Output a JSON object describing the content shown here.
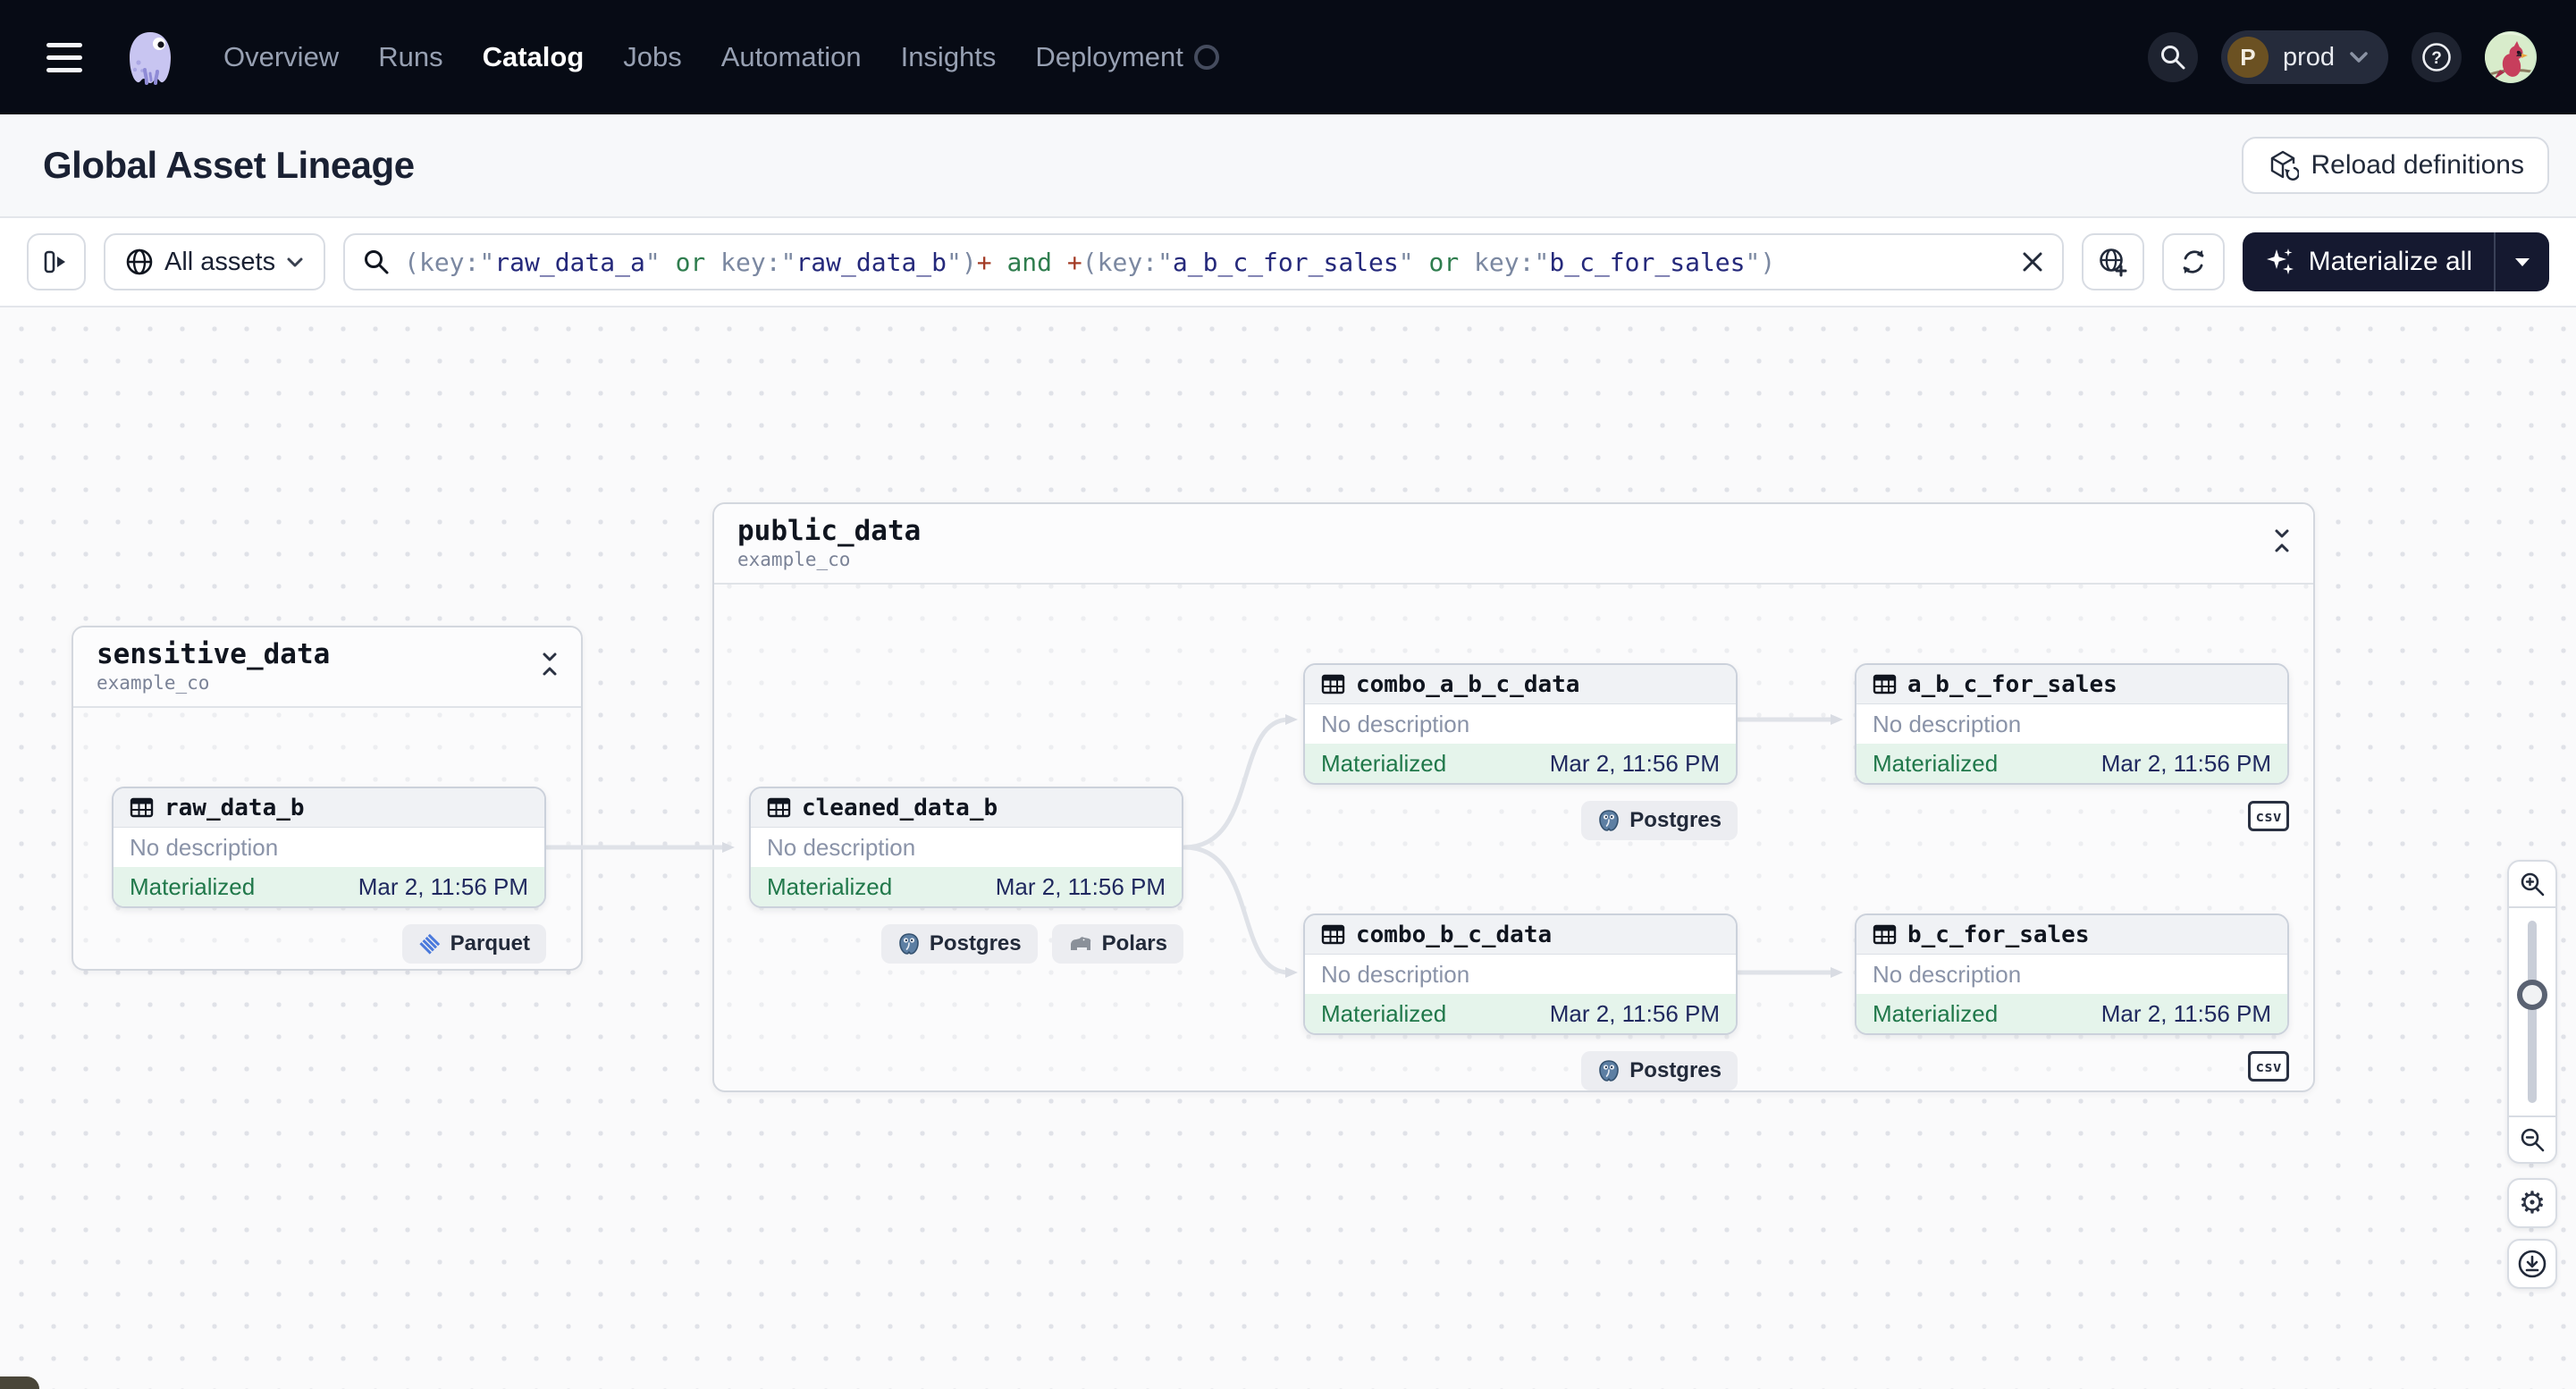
{
  "topnav": {
    "nav_items": [
      {
        "label": "Overview"
      },
      {
        "label": "Runs"
      },
      {
        "label": "Catalog"
      },
      {
        "label": "Jobs"
      },
      {
        "label": "Automation"
      },
      {
        "label": "Insights"
      },
      {
        "label": "Deployment"
      }
    ],
    "active_item": "Catalog",
    "deployment_switcher": {
      "initial": "P",
      "name": "prod"
    }
  },
  "page_header": {
    "title": "Global Asset Lineage",
    "reload_button": "Reload definitions"
  },
  "toolbar": {
    "scope_button": "All assets",
    "materialize_button": "Materialize all",
    "query_segments": [
      {
        "t": "(key:",
        "c": "p"
      },
      {
        "t": "\"",
        "c": "p"
      },
      {
        "t": "raw_data_a",
        "c": "v"
      },
      {
        "t": "\"",
        "c": "p"
      },
      {
        "t": " ",
        "c": "p"
      },
      {
        "t": "or",
        "c": "k"
      },
      {
        "t": " key:",
        "c": "p"
      },
      {
        "t": "\"",
        "c": "p"
      },
      {
        "t": "raw_data_b",
        "c": "v"
      },
      {
        "t": "\"",
        "c": "p"
      },
      {
        "t": ")",
        "c": "p"
      },
      {
        "t": "+",
        "c": "o"
      },
      {
        "t": " ",
        "c": "p"
      },
      {
        "t": "and",
        "c": "k"
      },
      {
        "t": " ",
        "c": "p"
      },
      {
        "t": "+",
        "c": "o"
      },
      {
        "t": "(key:",
        "c": "p"
      },
      {
        "t": "\"",
        "c": "p"
      },
      {
        "t": "a_b_c_for_sales",
        "c": "v"
      },
      {
        "t": "\"",
        "c": "p"
      },
      {
        "t": " ",
        "c": "p"
      },
      {
        "t": "or",
        "c": "k"
      },
      {
        "t": " key:",
        "c": "p"
      },
      {
        "t": "\"",
        "c": "p"
      },
      {
        "t": "b_c_for_sales",
        "c": "v"
      },
      {
        "t": "\"",
        "c": "p"
      },
      {
        "t": ")",
        "c": "p"
      }
    ]
  },
  "graph": {
    "groups": [
      {
        "name": "sensitive_data",
        "location": "example_co"
      },
      {
        "name": "public_data",
        "location": "example_co"
      }
    ],
    "nodes": [
      {
        "name": "raw_data_b",
        "group": "sensitive_data",
        "description": "No description",
        "status": "Materialized",
        "timestamp": "Mar 2, 11:56 PM",
        "badges": [
          "Parquet"
        ]
      },
      {
        "name": "cleaned_data_b",
        "group": "public_data",
        "description": "No description",
        "status": "Materialized",
        "timestamp": "Mar 2, 11:56 PM",
        "badges": [
          "Postgres",
          "Polars"
        ]
      },
      {
        "name": "combo_a_b_c_data",
        "group": "public_data",
        "description": "No description",
        "status": "Materialized",
        "timestamp": "Mar 2, 11:56 PM",
        "badges": [
          "Postgres"
        ]
      },
      {
        "name": "a_b_c_for_sales",
        "group": "public_data",
        "description": "No description",
        "status": "Materialized",
        "timestamp": "Mar 2, 11:56 PM",
        "badges": [
          "csv"
        ]
      },
      {
        "name": "combo_b_c_data",
        "group": "public_data",
        "description": "No description",
        "status": "Materialized",
        "timestamp": "Mar 2, 11:56 PM",
        "badges": [
          "Postgres"
        ]
      },
      {
        "name": "b_c_for_sales",
        "group": "public_data",
        "description": "No description",
        "status": "Materialized",
        "timestamp": "Mar 2, 11:56 PM",
        "badges": [
          "csv"
        ]
      }
    ],
    "edges": [
      {
        "from": "raw_data_b",
        "to": "cleaned_data_b"
      },
      {
        "from": "cleaned_data_b",
        "to": "combo_a_b_c_data"
      },
      {
        "from": "cleaned_data_b",
        "to": "combo_b_c_data"
      },
      {
        "from": "combo_a_b_c_data",
        "to": "a_b_c_for_sales"
      },
      {
        "from": "combo_b_c_data",
        "to": "b_c_for_sales"
      }
    ]
  },
  "colors": {
    "topnav_bg": "#070B15",
    "status_materialized_text": "#20784A",
    "status_materialized_bg": "#E5F4EB",
    "timestamp_text": "#20295F",
    "query_value": "#25297B",
    "query_keyword": "#2F7D4E",
    "query_operator": "#A33B25",
    "edge": "#DFE2E8"
  }
}
